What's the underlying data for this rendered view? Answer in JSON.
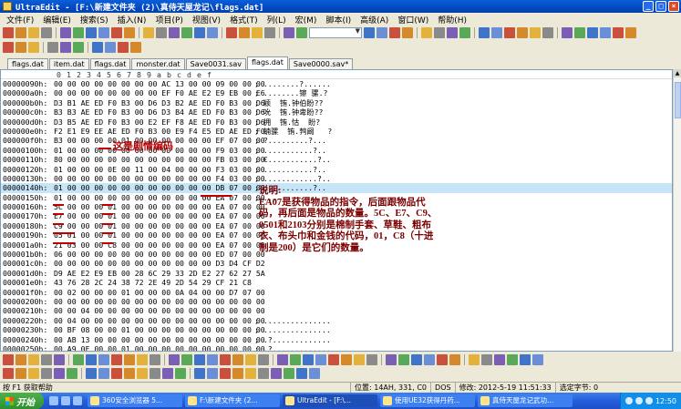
{
  "window": {
    "title": "UltraEdit - [F:\\新建文件夹 (2)\\真侍天屋龙记\\flags.dat]"
  },
  "menu": [
    "文件(F)",
    "编辑(E)",
    "搜索(S)",
    "插入(N)",
    "项目(P)",
    "视图(V)",
    "格式(T)",
    "列(L)",
    "宏(M)",
    "脚本(I)",
    "高级(A)",
    "窗口(W)",
    "帮助(H)"
  ],
  "tabs": [
    {
      "label": "flags.dat"
    },
    {
      "label": "item.dat"
    },
    {
      "label": "flags.dat"
    },
    {
      "label": "monster.dat"
    },
    {
      "label": "Save0031.sav"
    },
    {
      "label": "flags.dat",
      "active": true
    },
    {
      "label": "Save0000.sav*"
    }
  ],
  "ruler": {
    "offset": "",
    "cols": [
      "0",
      "1",
      "2",
      "3",
      "4",
      "5",
      "6",
      "7",
      "8",
      "9",
      "a",
      "b",
      "c",
      "d",
      "e",
      "f"
    ]
  },
  "rows": [
    {
      "off": "00000090h:",
      "hex": "00 00 00 00 00 00 00 00 AC 13 00 00 09 00 00 00",
      "asc": "; ........?......"
    },
    {
      "off": "000000a0h:",
      "hex": "00 00 00 00 00 00 00 00 EF F0 AE E2 E9 EB 00 E6",
      "asc": "; ........镲 骡.?"
    },
    {
      "off": "000000b0h:",
      "hex": "D3 B1 AE ED F0 B3 00 D6 D3 B2 AE ED F0 B3 00 D6",
      "asc": "; 颖  铕.钟伯盼??"
    },
    {
      "off": "000000c0h:",
      "hex": "B3 B3 AE ED F0 B3 00 D6 D3 B4 AE ED F0 B3 00 D6",
      "asc": "; 吮  铕.钟卑盼??"
    },
    {
      "off": "000000d0h:",
      "hex": "D3 B5 AE ED F0 B3 00 E2 EF F8 AE ED F0 B3 00 D6",
      "asc": "; 拥  铕.怙  盼?"
    },
    {
      "off": "000000e0h:",
      "hex": "F2 E1 E9 EE AE ED F0 B3 00 E9 F4 E5 ED AE ED F0",
      "asc": "; 蝻骡  铕.鹁阚   ?"
    },
    {
      "off": "000000f0h:",
      "hex": "B3 00 00 00 00 01 00 00 00 00 00 00 EF 07 00 00",
      "asc": "; ?.........?..."
    },
    {
      "off": "00000100h:",
      "hex": "01 00 00 00 00 00 00 00 00 00 00 00 F9 03 00 00",
      "asc": "; ...........?.."
    },
    {
      "off": "00000110h:",
      "hex": "80 00 00 00 00 00 00 00 00 00 00 00 FB 03 00 00",
      "asc": "; €...........?.."
    },
    {
      "off": "00000120h:",
      "hex": "01 00 00 00 0E 00 11 00 04 00 00 00 F3 03 00 00",
      "asc": "; ...........?.."
    },
    {
      "off": "00000130h:",
      "hex": "00 00 00 00 00 00 00 00 00 00 00 00 F4 03 00 00",
      "asc": "; ............?.."
    },
    {
      "off": "00000140h:",
      "hex": "01 00 00 00 00 00 00 00 00 00 00 00 DB 07 00 00",
      "asc": "; ...........?..",
      "hl": true
    },
    {
      "off": "00000150h:",
      "hex": "01 00 00 00 00 00 00 00 00 00 00 00 EA 07 00 00",
      "asc": "; ..."
    },
    {
      "off": "00000160h:",
      "hex": "5C 00 00 00 01 00 00 00 00 00 00 00 EA 07 00 00",
      "asc": ""
    },
    {
      "off": "00000170h:",
      "hex": "E7 00 00 00 01 00 00 00 00 00 00 00 EA 07 00 00",
      "asc": ""
    },
    {
      "off": "00000180h:",
      "hex": "C9 00 00 00 01 00 00 00 00 00 00 00 EA 07 00 00",
      "asc": ""
    },
    {
      "off": "00000190h:",
      "hex": "05 01 00 00 01 00 00 00 00 00 00 00 EA 07 00 00",
      "asc": ""
    },
    {
      "off": "000001a0h:",
      "hex": "21 03 00 00 C8 00 00 00 00 00 00 00 EA 07 00 00",
      "asc": ""
    },
    {
      "off": "000001b0h:",
      "hex": "06 00 00 00 00 00 00 00 00 00 00 00 ED 07 00 00",
      "asc": ""
    },
    {
      "off": "000001c0h:",
      "hex": "00 00 00 00 00 00 00 00 00 00 00 00 D3 D4 CF D2",
      "asc": ""
    },
    {
      "off": "000001d0h:",
      "hex": "D9 AE E2 E9 EB 00 28 6C 29 33 2D E2 27 62 27 5A",
      "asc": ""
    },
    {
      "off": "000001e0h:",
      "hex": "43 76 28 2C 24 38 72 2E 49 2D 54 29 CF 21 C8",
      "asc": ""
    },
    {
      "off": "000001f0h:",
      "hex": "00 02 00 00 00 01 00 00 00 0A 04 00 00 D7 07 00",
      "asc": ""
    },
    {
      "off": "00000200h:",
      "hex": "00 00 00 00 00 00 00 00 00 00 00 00 00 00 00 00",
      "asc": ""
    },
    {
      "off": "00000210h:",
      "hex": "00 00 04 00 00 00 00 00 00 00 00 00 00 00 00 00",
      "asc": ""
    },
    {
      "off": "00000220h:",
      "hex": "00 04 00 00 00 00 00 00 00 00 00 00 00 00 00 00",
      "asc": "; ..............."
    },
    {
      "off": "00000230h:",
      "hex": "00 BF 08 00 00 01 00 00 00 00 00 00 00 00 00 00",
      "asc": "; ..............."
    },
    {
      "off": "00000240h:",
      "hex": "00 AB 13 00 00 00 00 00 00 00 00 00 00 00 00 00",
      "asc": "; .?............."
    },
    {
      "off": "00000250h:",
      "hex": "00 A9 0F 00 00 01 00 00 00 00 00 00 00 00 00 00",
      "asc": "; .?............."
    },
    {
      "off": "00000260h:",
      "hex": "27 F2 03 00 00 00 00 00 00 00 00 00 00 00 00 00",
      "asc": "; '?............."
    }
  ],
  "annotations": {
    "label": "这是剧情编码",
    "note": "说明:\nEA07是获得物品的指令，后面跟物品代码，再后面是物品的数量。5C、E7、C9、0501和2103分别是棉制手套、草鞋、粗布衣、布头巾和金钱的代码，01，C8（十进制是200）是它们的数量。"
  },
  "status": {
    "help": "按 F1 获取帮助",
    "position": "位置: 14AH, 331, C0",
    "format": "DOS",
    "modified": "修改: 2012-5-19 11:51:33",
    "selection": "选定字节: 0"
  },
  "taskbar": {
    "start": "开始",
    "tasks": [
      {
        "label": "360安全浏览器 5..."
      },
      {
        "label": "F:\\新建文件夹 (2..."
      },
      {
        "label": "UltraEdit - [F:\\...",
        "active": true
      },
      {
        "label": "使用UE32获得丹药..."
      },
      {
        "label": "真侍天屋龙记武功..."
      }
    ],
    "clock": "12:50"
  },
  "colors": {
    "highlight_row": "#c6e6f8",
    "annotation": "#7a0000",
    "underline": "#c00000"
  }
}
